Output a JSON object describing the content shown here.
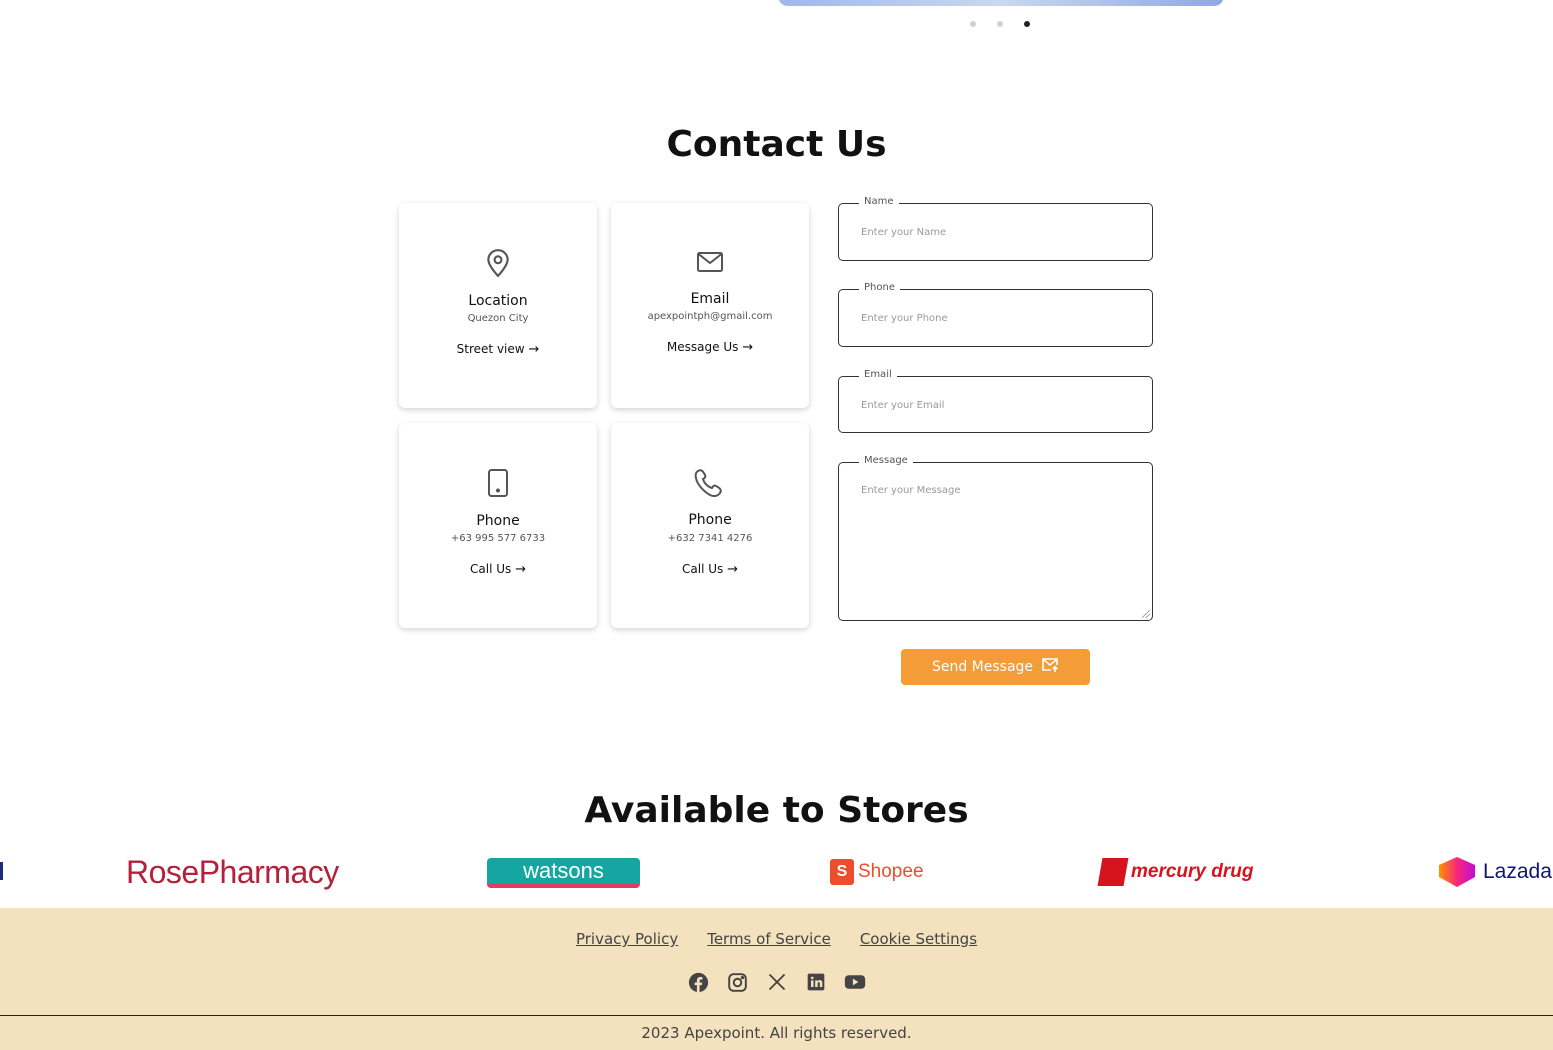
{
  "carousel": {
    "dot_count": 3,
    "active_index": 2
  },
  "contact": {
    "title": "Contact Us",
    "cards": [
      {
        "icon": "location-pin-icon",
        "title": "Location",
        "sub": "Quezon City",
        "link": "Street view"
      },
      {
        "icon": "envelope-icon",
        "title": "Email",
        "sub": "apexpointph@gmail.com",
        "link": "Message Us"
      },
      {
        "icon": "mobile-phone-icon",
        "title": "Phone",
        "sub": "+63 995 577 6733",
        "link": "Call Us"
      },
      {
        "icon": "telephone-icon",
        "title": "Phone",
        "sub": "+632 7341 4276",
        "link": "Call Us"
      }
    ],
    "form": {
      "name": {
        "label": "Name",
        "placeholder": "Enter your Name",
        "value": ""
      },
      "phone": {
        "label": "Phone",
        "placeholder": "Enter your Phone",
        "value": ""
      },
      "email": {
        "label": "Email",
        "placeholder": "Enter your Email",
        "value": ""
      },
      "message": {
        "label": "Message",
        "placeholder": "Enter your Message",
        "value": ""
      },
      "submit_label": "Send Message"
    }
  },
  "stores": {
    "title": "Available to Stores",
    "items": [
      {
        "name": "RosePharmacy",
        "text": "RosePharmacy"
      },
      {
        "name": "watsons",
        "text": "watsons"
      },
      {
        "name": "Shopee",
        "text": "Shopee",
        "badge": "S"
      },
      {
        "name": "mercury drug",
        "text": "mercury drug"
      },
      {
        "name": "Lazada",
        "text": "Lazada"
      }
    ]
  },
  "footer": {
    "links": [
      "Privacy Policy",
      "Terms of Service",
      "Cookie Settings"
    ],
    "socials": [
      "facebook-icon",
      "instagram-icon",
      "x-icon",
      "linkedin-icon",
      "youtube-icon"
    ],
    "copyright": "2023 Apexpoint. All rights reserved."
  },
  "colors": {
    "accent": "#f39c38",
    "footer_bg": "#f3e2bd"
  }
}
